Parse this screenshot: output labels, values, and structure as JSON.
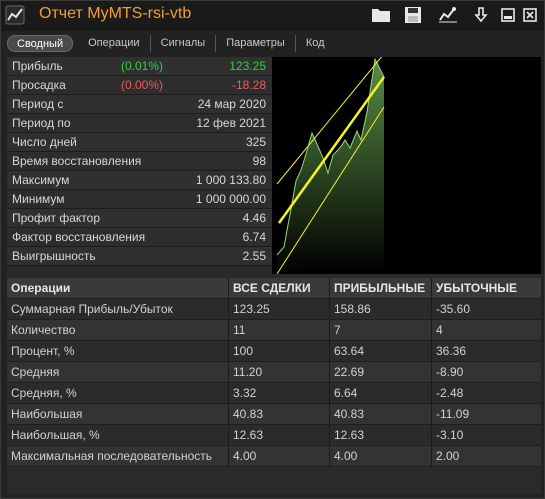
{
  "window": {
    "title": "Отчет MyMTS-rsi-vtb"
  },
  "toolbar": {
    "icons": [
      "folder-icon",
      "save-icon",
      "chart-settings-icon",
      "download-icon",
      "minimize-icon",
      "close-icon"
    ]
  },
  "tabs": [
    {
      "label": "Сводный",
      "active": true
    },
    {
      "label": "Операции",
      "active": false
    },
    {
      "label": "Сигналы",
      "active": false
    },
    {
      "label": "Параметры",
      "active": false
    },
    {
      "label": "Код",
      "active": false
    }
  ],
  "summary": [
    {
      "label": "Прибыль",
      "pct": "(0.01%)",
      "pct_color": "green",
      "value": "123.25",
      "value_color": "green"
    },
    {
      "label": "Просадка",
      "pct": "(0.00%)",
      "pct_color": "red",
      "value": "-18.28",
      "value_color": "red"
    },
    {
      "label": "Период с",
      "pct": "",
      "value": "24 мар 2020"
    },
    {
      "label": "Период по",
      "pct": "",
      "value": "12 фев 2021"
    },
    {
      "label": "Число дней",
      "pct": "",
      "value": "325"
    },
    {
      "label": "Время восстановления",
      "pct": "",
      "value": "98"
    },
    {
      "label": "Максимум",
      "pct": "",
      "value": "1 000 133.80"
    },
    {
      "label": "Минимум",
      "pct": "",
      "value": "1 000 000.00"
    },
    {
      "label": "Профит фактор",
      "pct": "",
      "value": "4.46"
    },
    {
      "label": "Фактор восстановления",
      "pct": "",
      "value": "6.74"
    },
    {
      "label": "Выигрышность",
      "pct": "",
      "value": "2.55"
    }
  ],
  "equity_chart": {
    "colors": {
      "fill": "#4a7a35",
      "line": "#9bd37a",
      "channel": "#f5f520"
    }
  },
  "details": {
    "headers": [
      "Операции",
      "ВСЕ СДЕЛКИ",
      "ПРИБЫЛЬНЫЕ",
      "УБЫТОЧНЫЕ"
    ],
    "rows": [
      [
        "Суммарная Прибыль/Убыток",
        "123.25",
        "158.86",
        "-35.60"
      ],
      [
        "Количество",
        "11",
        "7",
        "4"
      ],
      [
        "Процент, %",
        "100",
        "63.64",
        "36.36"
      ],
      [
        "Средняя",
        "11.20",
        "22.69",
        "-8.90"
      ],
      [
        "Средняя, %",
        "3.32",
        "6.64",
        "-2.48"
      ],
      [
        "Наибольшая",
        "40.83",
        "40.83",
        "-11.09"
      ],
      [
        "Наибольшая, %",
        "12.63",
        "12.63",
        "-3.10"
      ],
      [
        "Максимальная последовательность",
        "4.00",
        "4.00",
        "2.00"
      ]
    ]
  }
}
